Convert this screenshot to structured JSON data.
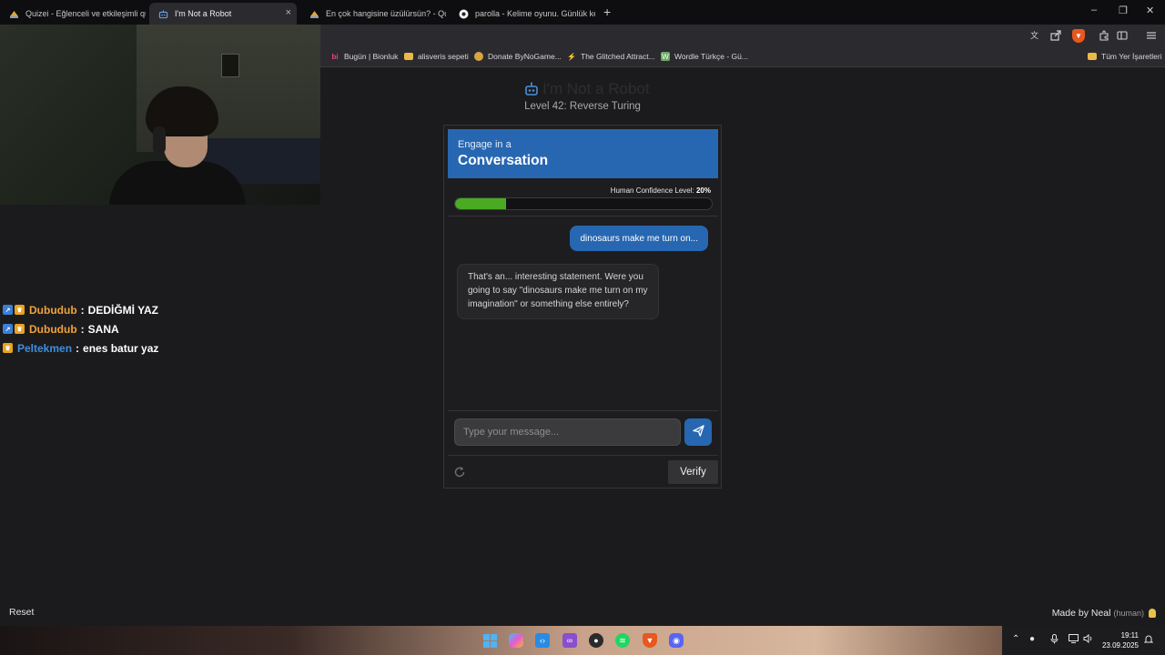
{
  "browser": {
    "tabs": [
      {
        "title": "Quizei - Eğlenceli ve etkileşimli quizle",
        "active": false,
        "icon": "quizei-icon"
      },
      {
        "title": "I'm Not a Robot",
        "active": true,
        "icon": "robot-icon"
      },
      {
        "title": "En çok hangisine üzülürsün? - Quizei",
        "active": false,
        "icon": "quizei-icon"
      },
      {
        "title": "parolla - Kelime oyunu. Günlük kelime",
        "active": false,
        "icon": "parolla-icon"
      }
    ],
    "tab_close": "×",
    "new_tab": "+",
    "window_controls": {
      "minimize": "–",
      "restore": "❐",
      "close": "✕"
    },
    "toolbar_icons": [
      "translate-icon",
      "share-icon",
      "brave-shields-icon",
      "extensions-icon",
      "sidebar-icon",
      "menu-icon"
    ],
    "bookmarks": [
      {
        "label": "Bugün | Bionluk",
        "icon": "bionluk-icon"
      },
      {
        "label": "alisveris sepeti",
        "icon": "folder-icon"
      },
      {
        "label": "Donate ByNoGame...",
        "icon": "bynogame-icon"
      },
      {
        "label": "The Glitched Attract...",
        "icon": "glitched-icon"
      },
      {
        "label": "Wordle Türkçe - Gü...",
        "icon": "wordle-icon"
      }
    ],
    "other_bookmarks": "Tüm Yer İşaretleri"
  },
  "stream_chat": [
    {
      "username": "Dubudub",
      "message": "DEDİĞMİ YAZ",
      "badges": [
        "blue",
        "gold"
      ],
      "color": "#f0a239"
    },
    {
      "username": "Dubudub",
      "message": "SANA",
      "badges": [
        "blue",
        "gold"
      ],
      "color": "#f0a239"
    },
    {
      "username": "Peltekmen",
      "message": "enes batur yaz",
      "badges": [
        "gold"
      ],
      "color": "#3d8fe0"
    }
  ],
  "page": {
    "title": "I'm Not a Robot",
    "subtitle": "Level 42: Reverse Turing"
  },
  "card": {
    "header_small": "Engage in a",
    "header_big": "Conversation",
    "confidence_label": "Human Confidence Level:",
    "confidence_value": "20%",
    "confidence_fraction": 0.2,
    "messages": {
      "user": "dinosaurs make me turn on...",
      "bot": "That's an... interesting statement. Were you going to say \"dinosaurs make me turn on my imagination\" or something else entirely?"
    },
    "input_placeholder": "Type your message...",
    "verify_label": "Verify"
  },
  "footer": {
    "reset_label": "Reset",
    "made_by": "Made by Neal",
    "human_tag": "(human)"
  },
  "taskbar": {
    "time": "19:11",
    "date": "23.09.2025",
    "apps": [
      "windows-start-icon",
      "copilot-icon",
      "vscode-icon",
      "visual-studio-icon",
      "obs-icon",
      "spotify-icon",
      "brave-icon",
      "discord-icon"
    ]
  },
  "colors": {
    "accent": "#2767b2",
    "progress": "#4aab22",
    "background": "#1b1b1d"
  }
}
